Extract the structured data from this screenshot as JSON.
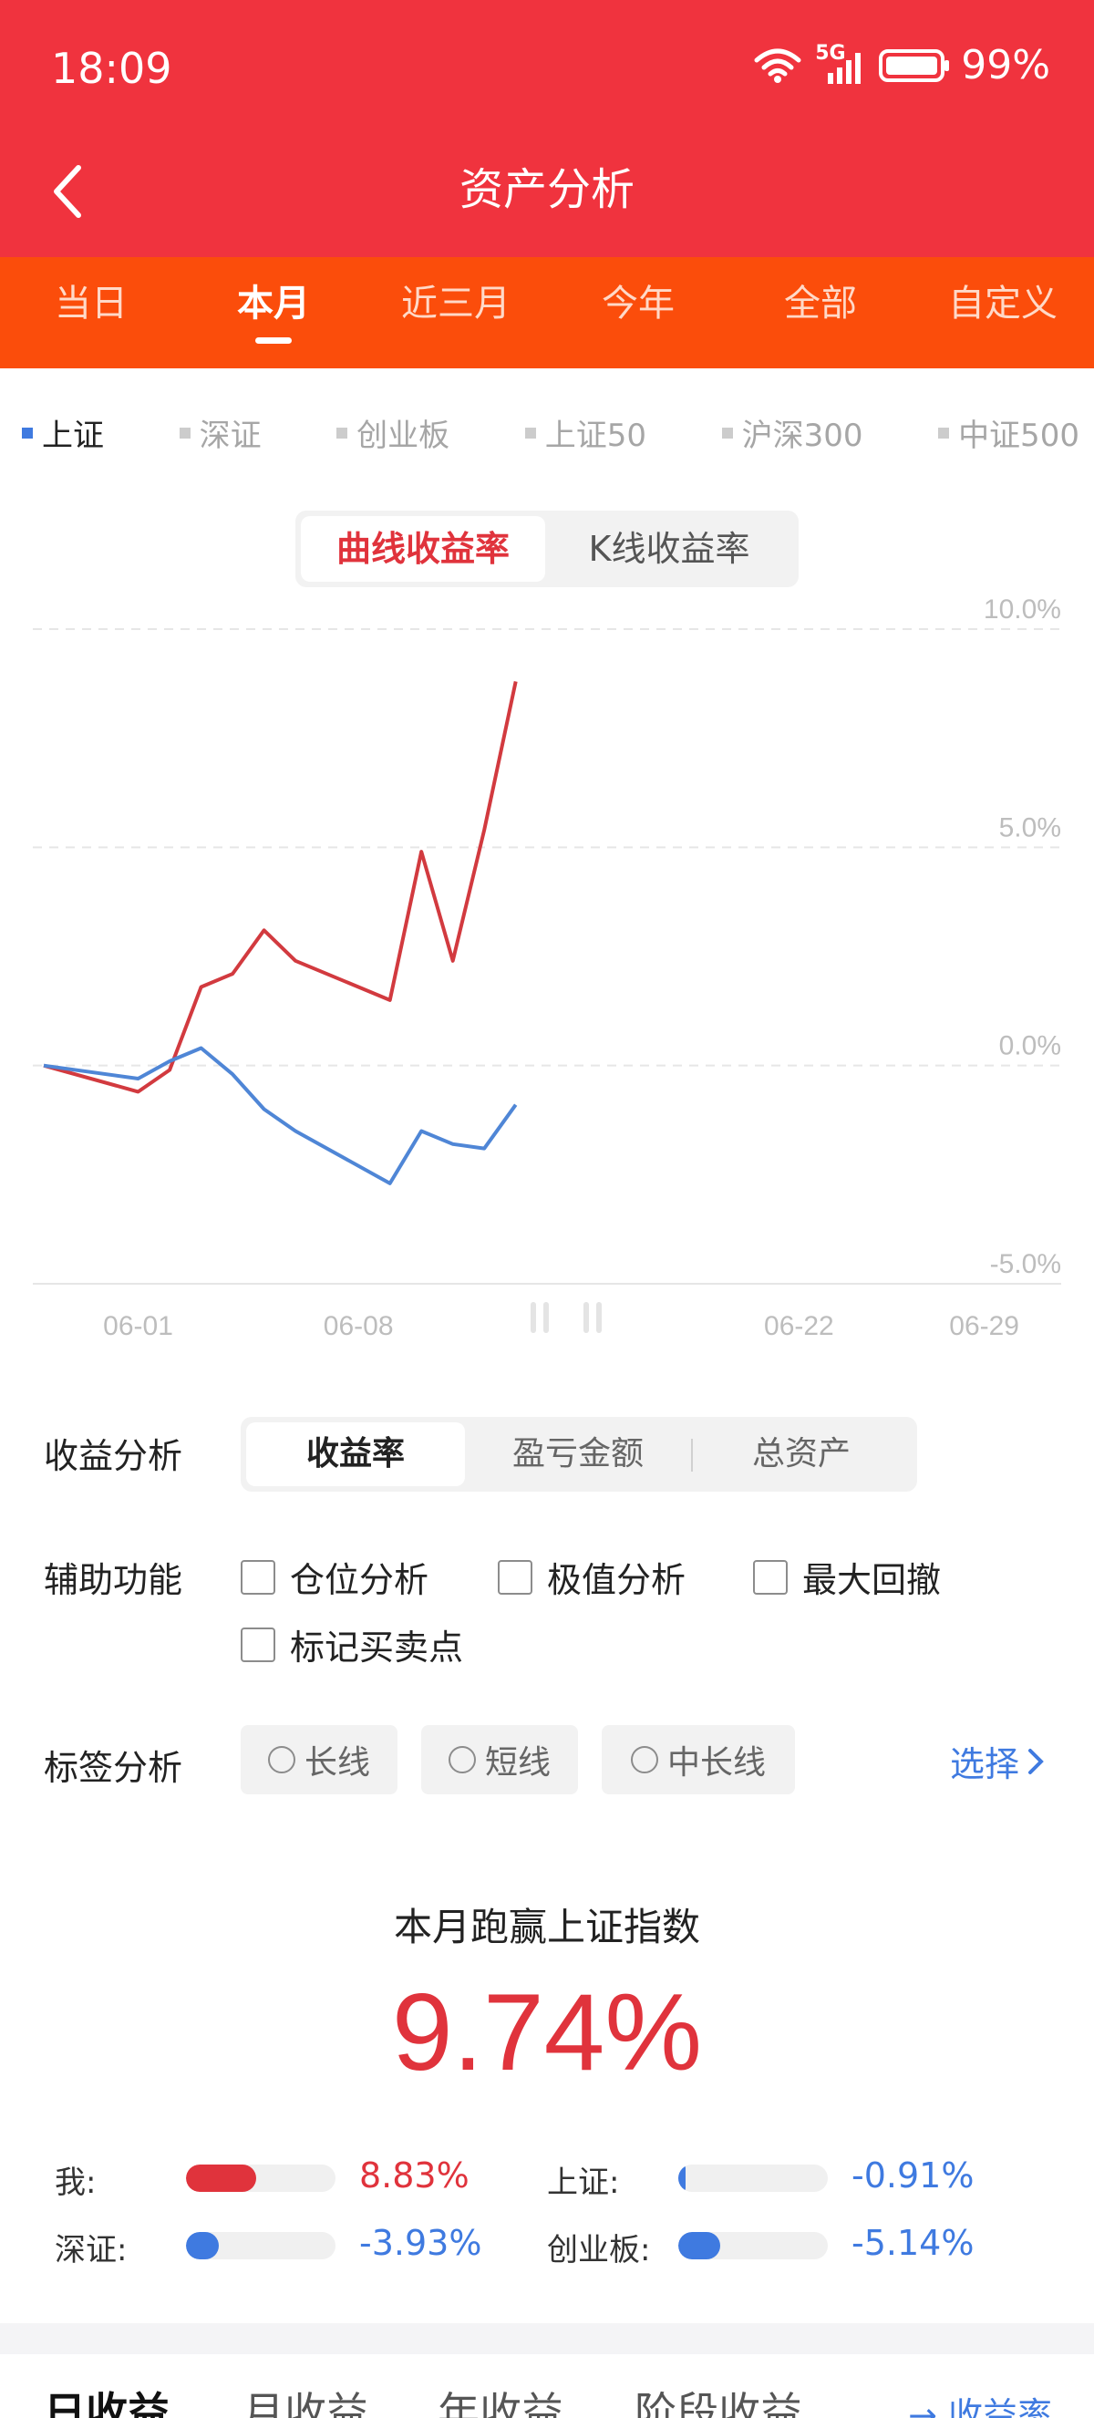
{
  "status": {
    "time": "18:09",
    "battery": "99%",
    "network": "5G"
  },
  "header": {
    "title": "资产分析"
  },
  "tabs": [
    {
      "label": "当日"
    },
    {
      "label": "本月"
    },
    {
      "label": "近三月"
    },
    {
      "label": "今年"
    },
    {
      "label": "全部"
    },
    {
      "label": "自定义"
    }
  ],
  "active_tab": "本月",
  "legend": [
    {
      "label": "上证",
      "active": true
    },
    {
      "label": "深证"
    },
    {
      "label": "创业板"
    },
    {
      "label": "上证50"
    },
    {
      "label": "沪深300"
    },
    {
      "label": "中证500"
    }
  ],
  "chart_toggle": {
    "option1": "曲线收益率",
    "option2": "K线收益率"
  },
  "chart_data": {
    "type": "line",
    "y_ticks": [
      "10.0%",
      "5.0%",
      "0.0%",
      "-5.0%"
    ],
    "ylim": [
      -5,
      10
    ],
    "x_ticks": [
      "06-01",
      "06-08",
      "06-22",
      "06-29"
    ],
    "x_tick_days": [
      1,
      8,
      22,
      29
    ],
    "xlim": [
      -2,
      29
    ],
    "grid": true,
    "series": [
      {
        "color": "#d23a3f",
        "x": [
          -2,
          1,
          2,
          3,
          4,
          5,
          6,
          9,
          10,
          11,
          12,
          13
        ],
        "y": [
          0.0,
          -0.6,
          -0.1,
          1.8,
          2.1,
          3.1,
          2.4,
          1.5,
          4.9,
          2.4,
          5.4,
          8.8
        ]
      },
      {
        "color": "#4f86d6",
        "x": [
          -2,
          1,
          2,
          3,
          4,
          5,
          6,
          9,
          10,
          11,
          12,
          13
        ],
        "y": [
          0.0,
          -0.3,
          0.1,
          0.4,
          -0.2,
          -1.0,
          -1.5,
          -2.7,
          -1.5,
          -1.8,
          -1.9,
          -0.9
        ]
      }
    ]
  },
  "analysis": {
    "label": "收益分析",
    "options": [
      "收益率",
      "盈亏金额",
      "总资产"
    ]
  },
  "aux": {
    "label": "辅助功能",
    "checks": [
      "仓位分析",
      "极值分析",
      "最大回撤",
      "标记买卖点"
    ]
  },
  "tags": {
    "label": "标签分析",
    "options": [
      "长线",
      "短线",
      "中长线"
    ],
    "choose": "选择"
  },
  "summary": {
    "title": "本月跑赢上证指数",
    "value": "9.74%"
  },
  "compare": [
    {
      "label": "我:",
      "value": "8.83%",
      "fraction": 0.47,
      "color": "#e0333c"
    },
    {
      "label": "上证:",
      "value": "-0.91%",
      "fraction": 0.05,
      "color": "#3f7ae0"
    },
    {
      "label": "深证:",
      "value": "-3.93%",
      "fraction": 0.22,
      "color": "#3f7ae0"
    },
    {
      "label": "创业板:",
      "value": "-5.14%",
      "fraction": 0.28,
      "color": "#3f7ae0"
    }
  ],
  "bottom_tabs": [
    "日收益",
    "月收益",
    "年收益",
    "阶段收益"
  ],
  "bottom_right": "收益率"
}
